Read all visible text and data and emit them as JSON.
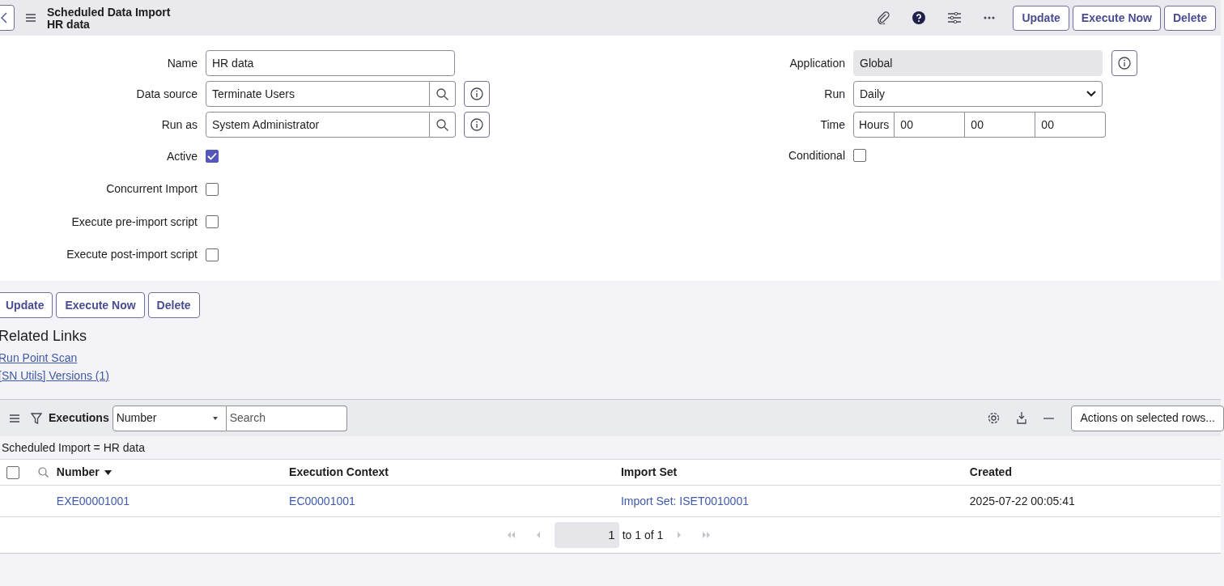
{
  "header": {
    "title": "Scheduled Data Import",
    "subtitle": "HR data",
    "buttons": [
      "Update",
      "Execute Now",
      "Delete"
    ]
  },
  "form_left": [
    {
      "kind": "text",
      "label": "Name",
      "value": "HR data"
    },
    {
      "kind": "reference",
      "label": "Data source",
      "value": "Terminate Users"
    },
    {
      "kind": "reference",
      "label": "Run as",
      "value": "System Administrator"
    },
    {
      "kind": "checkbox",
      "label": "Active",
      "checked": true
    },
    {
      "kind": "checkbox",
      "label": "Concurrent Import",
      "checked": false
    },
    {
      "kind": "checkbox",
      "label": "Execute pre-import script",
      "checked": false
    },
    {
      "kind": "checkbox",
      "label": "Execute post-import script",
      "checked": false
    }
  ],
  "form_right": [
    {
      "kind": "readonly",
      "label": "Application",
      "value": "Global"
    },
    {
      "kind": "select",
      "label": "Run",
      "value": "Daily"
    },
    {
      "kind": "time",
      "label": "Time",
      "prefix": "Hours",
      "values": [
        "00",
        "00",
        "00"
      ]
    },
    {
      "kind": "checkbox",
      "label": "Conditional",
      "checked": false
    }
  ],
  "footer_buttons": [
    "Update",
    "Execute Now",
    "Delete"
  ],
  "related_links": {
    "title": "Related Links",
    "links": [
      "Run Point Scan",
      "[SN Utils] Versions (1)"
    ]
  },
  "related_list": {
    "title": "Executions",
    "search_field": "Number",
    "search_placeholder": "Search",
    "actions": "Actions on selected rows...",
    "filter": "Scheduled Import = HR data",
    "select_all": {
      "checked": false
    },
    "columns": [
      {
        "label": "Number",
        "sorted": true
      },
      {
        "label": "Execution Context",
        "sorted": false
      },
      {
        "label": "Import Set",
        "sorted": false
      },
      {
        "label": "Created",
        "sorted": false
      }
    ],
    "rows": [
      {
        "selected": false,
        "cells": [
          "EXE00001001",
          "EC00001001",
          "Import Set: ISET0010001",
          "2025-07-22 00:05:41"
        ]
      }
    ],
    "pagination": {
      "page": "1",
      "range": "to 1 of 1"
    }
  }
}
